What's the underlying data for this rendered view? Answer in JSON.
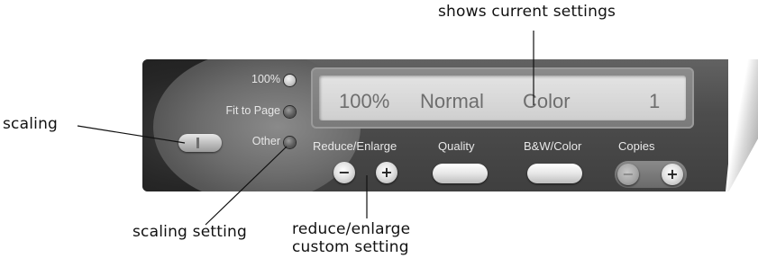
{
  "callouts": {
    "top": "shows current settings",
    "scaling": "scaling",
    "scaling_setting": "scaling setting",
    "reduce_line1": "reduce/enlarge",
    "reduce_line2": "custom setting"
  },
  "display": {
    "scale": "100%",
    "quality": "Normal",
    "color": "Color",
    "copies": "1"
  },
  "scaling_options": [
    {
      "label": "100%",
      "selected": true
    },
    {
      "label": "Fit to Page",
      "selected": false
    },
    {
      "label": "Other",
      "selected": false
    }
  ],
  "controls": {
    "reduce_enlarge_label": "Reduce/Enlarge",
    "quality_label": "Quality",
    "bw_color_label": "B&W/Color",
    "copies_label": "Copies",
    "minus_symbol": "−",
    "plus_symbol": "+"
  },
  "icons": {
    "minus": "minus-icon",
    "plus": "plus-icon"
  },
  "colors": {
    "panel": "#4d4d4d",
    "display_bg": "#d9d9d9",
    "display_text": "#6e6e6e",
    "label_text": "#e8e8e8"
  }
}
